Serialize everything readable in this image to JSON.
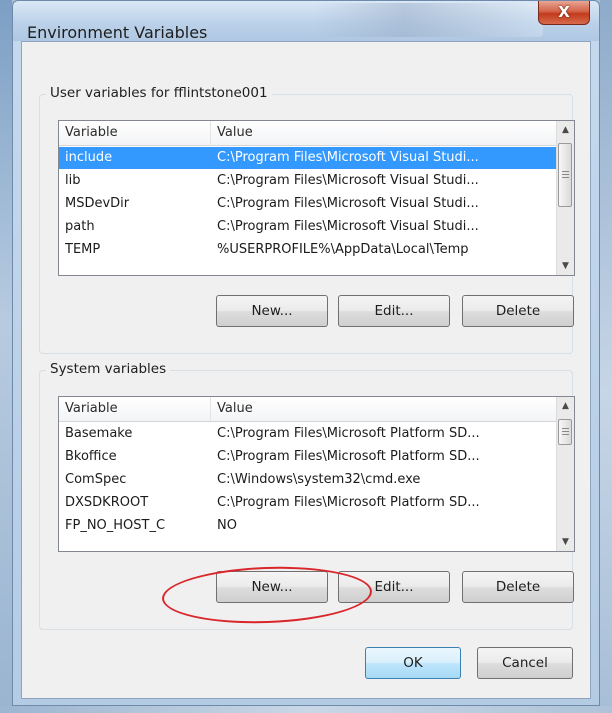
{
  "window": {
    "title": "Environment Variables",
    "close_glyph": "X"
  },
  "user_vars": {
    "group_label": "User variables for fflintstone001",
    "columns": {
      "variable": "Variable",
      "value": "Value"
    },
    "rows": [
      {
        "variable": "include",
        "value": "C:\\Program Files\\Microsoft Visual Studi..."
      },
      {
        "variable": "lib",
        "value": "C:\\Program Files\\Microsoft Visual Studi..."
      },
      {
        "variable": "MSDevDir",
        "value": "C:\\Program Files\\Microsoft Visual Studi..."
      },
      {
        "variable": "path",
        "value": "C:\\Program Files\\Microsoft Visual Studi..."
      },
      {
        "variable": "TEMP",
        "value": "%USERPROFILE%\\AppData\\Local\\Temp"
      }
    ],
    "selected_index": 0,
    "buttons": {
      "new": "New...",
      "edit": "Edit...",
      "delete": "Delete"
    }
  },
  "system_vars": {
    "group_label": "System variables",
    "columns": {
      "variable": "Variable",
      "value": "Value"
    },
    "rows": [
      {
        "variable": "Basemake",
        "value": "C:\\Program Files\\Microsoft Platform SD..."
      },
      {
        "variable": "Bkoffice",
        "value": "C:\\Program Files\\Microsoft Platform SD..."
      },
      {
        "variable": "ComSpec",
        "value": "C:\\Windows\\system32\\cmd.exe"
      },
      {
        "variable": "DXSDKROOT",
        "value": "C:\\Program Files\\Microsoft Platform SD..."
      },
      {
        "variable": "FP_NO_HOST_C",
        "value": "NO"
      }
    ],
    "buttons": {
      "new": "New...",
      "edit": "Edit...",
      "delete": "Delete"
    }
  },
  "footer": {
    "ok": "OK",
    "cancel": "Cancel"
  },
  "colors": {
    "selection": "#3399ff",
    "annotation": "#d9262b",
    "close_button": "#c23a1c"
  },
  "icons": [
    "close-icon",
    "scroll-up-arrow-icon",
    "scroll-down-arrow-icon",
    "scroll-grip-icon"
  ]
}
